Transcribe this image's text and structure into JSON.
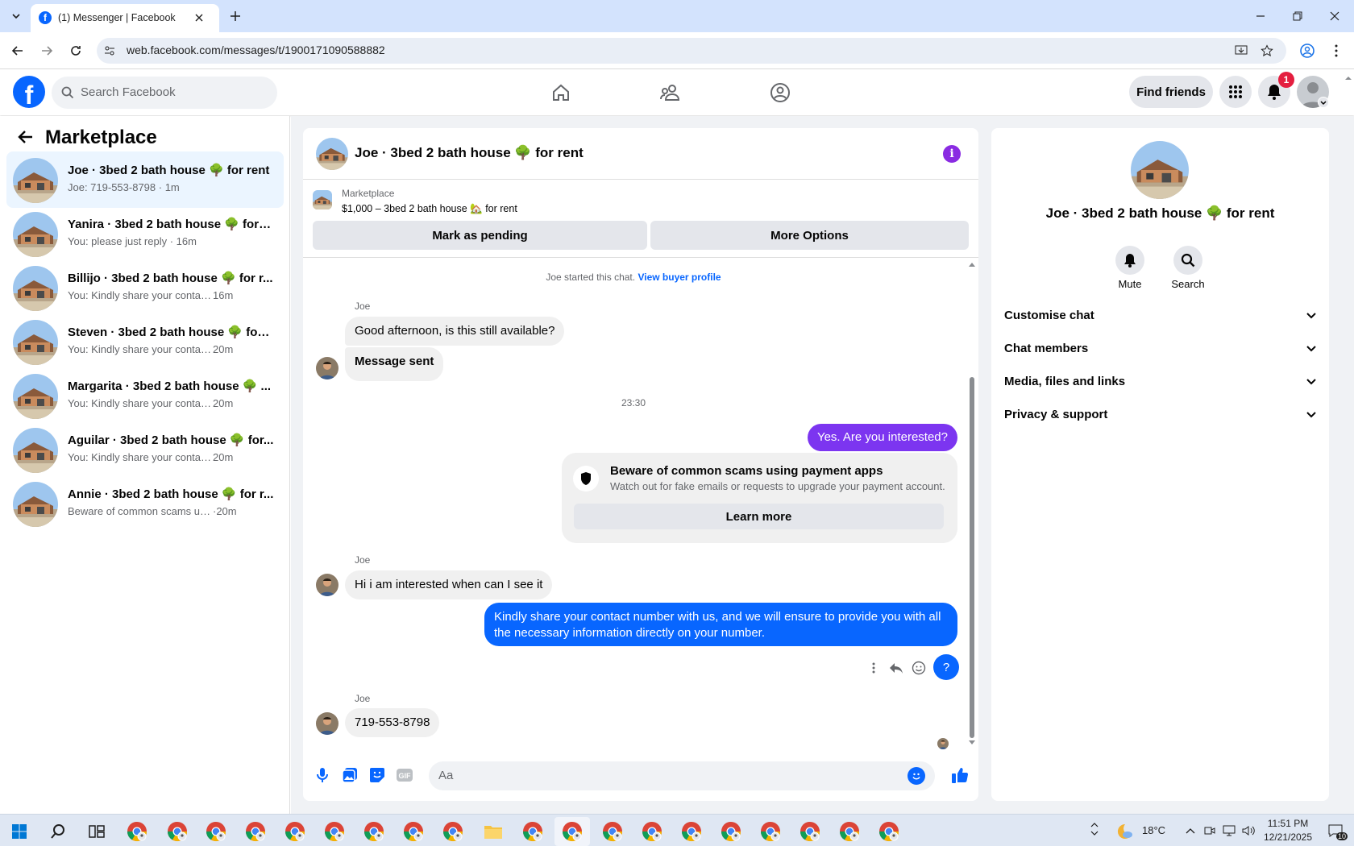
{
  "browser": {
    "tab_title": "(1) Messenger | Facebook",
    "url": "web.facebook.com/messages/t/1900171090588882"
  },
  "header": {
    "search_placeholder": "Search Facebook",
    "find_friends": "Find friends",
    "notification_count": "1"
  },
  "sidebar": {
    "title": "Marketplace",
    "conversations": [
      {
        "name": "Joe · 3bed 2 bath house 🌳 for rent",
        "preview": "Joe: 719-553-8798 · 1m",
        "time": "",
        "selected": true
      },
      {
        "name": "Yanira · 3bed 2 bath house 🌳 for r...",
        "preview": "You: please just reply · 16m",
        "time": ""
      },
      {
        "name": "Billijo · 3bed 2 bath house 🌳 for r...",
        "preview": "You: Kindly share your contact num...",
        "time": "16m"
      },
      {
        "name": "Steven · 3bed 2 bath house 🌳 for ...",
        "preview": "You: Kindly share your contact num...",
        "time": "20m"
      },
      {
        "name": "Margarita · 3bed 2 bath house 🌳 ...",
        "preview": "You: Kindly share your contact num...",
        "time": "20m"
      },
      {
        "name": "Aguilar · 3bed 2 bath house 🌳 for...",
        "preview": "You: Kindly share your contact num...",
        "time": "20m"
      },
      {
        "name": "Annie · 3bed 2 bath house 🌳 for r...",
        "preview": "Beware of common scams using pa...",
        "time": "·20m"
      }
    ]
  },
  "chat": {
    "title": "Joe · 3bed 2 bath house 🌳 for rent",
    "listing_label": "Marketplace",
    "listing_detail": "$1,000 – 3bed 2 bath house 🏡 for rent",
    "mark_pending": "Mark as pending",
    "more_options": "More Options",
    "started_text": "Joe started this chat.",
    "view_profile": "View buyer profile",
    "sender_name": "Joe",
    "msg1": "Good afternoon, is this still available?",
    "msg2": "Message sent",
    "timestamp": "23:30",
    "msg3": "Yes. Are you interested?",
    "scam_title": "Beware of common scams using payment apps",
    "scam_body": "Watch out for fake emails or requests to upgrade your payment account.",
    "learn_more": "Learn more",
    "msg4": "Hi i am interested when can I see it",
    "msg5": "Kindly share your contact number with us, and we will ensure to provide you with all the necessary information directly on your number.",
    "msg6": "719-553-8798",
    "composer_placeholder": "Aa",
    "help_label": "?",
    "accent_color": "#0866ff",
    "outgoing_color": "#7c35f0"
  },
  "right_panel": {
    "title": "Joe · 3bed 2 bath house 🌳 for rent",
    "mute": "Mute",
    "search": "Search",
    "sections": [
      "Customise chat",
      "Chat members",
      "Media, files and links",
      "Privacy & support"
    ]
  },
  "taskbar": {
    "temperature": "18°C",
    "time": "11:51 PM",
    "date": "12/21/2025",
    "notif_count": "10"
  }
}
